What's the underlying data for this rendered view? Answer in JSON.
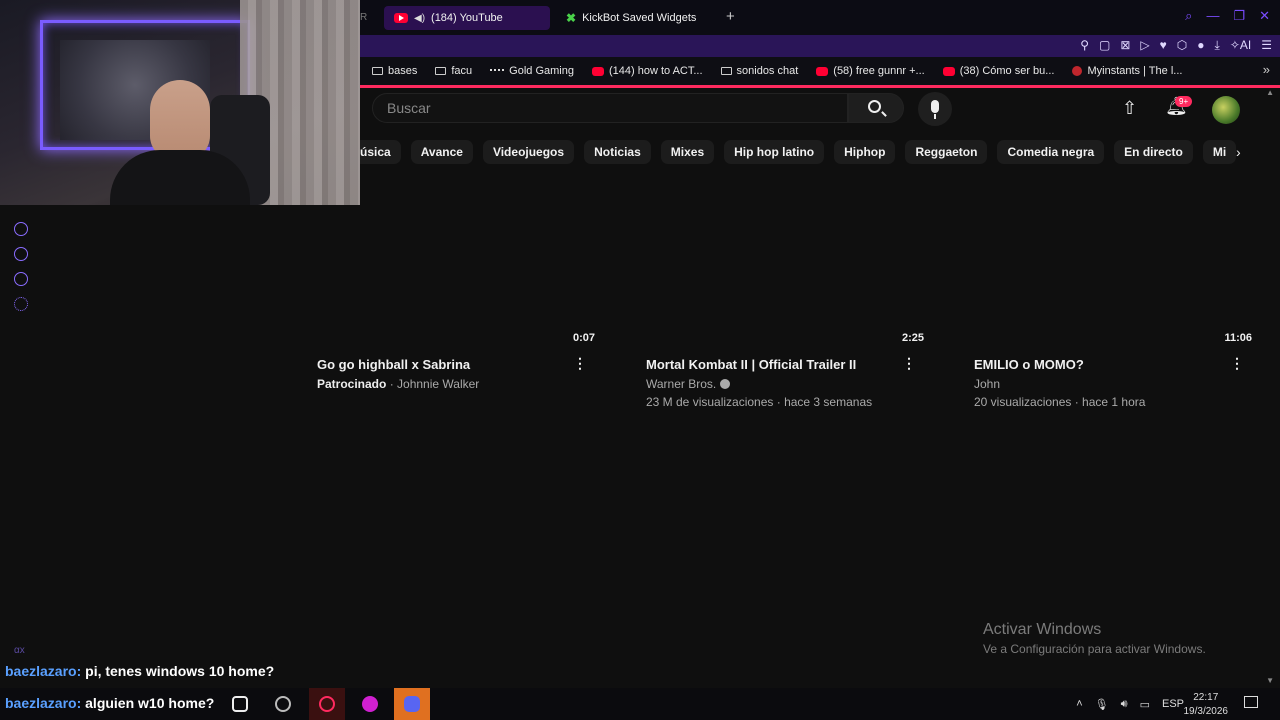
{
  "browser": {
    "tab_fragment": "R",
    "tabs": [
      {
        "label": "(184) YouTube",
        "active": true
      },
      {
        "label": "KickBot Saved Widgets",
        "active": false
      }
    ],
    "new_tab_icon": "plus-icon",
    "toolbar_ai_label": "AI",
    "bookmarks": [
      {
        "label": "bases",
        "icon": "folder-icon"
      },
      {
        "label": "facu",
        "icon": "folder-icon"
      },
      {
        "label": "Gold Gaming",
        "icon": "gold-icon"
      },
      {
        "label": "(144) how to ACT...",
        "icon": "youtube-icon"
      },
      {
        "label": "sonidos chat",
        "icon": "folder-icon"
      },
      {
        "label": "(58) free gunnr +...",
        "icon": "youtube-icon"
      },
      {
        "label": "(38) Cómo ser bu...",
        "icon": "youtube-icon"
      },
      {
        "label": "Myinstants | The l...",
        "icon": "myinstants-icon"
      }
    ]
  },
  "youtube": {
    "search_placeholder": "Buscar",
    "notification_badge": "9+",
    "chips": [
      "úsica",
      "Avance",
      "Videojuegos",
      "Noticias",
      "Mixes",
      "Hip hop latino",
      "Hiphop",
      "Reggaeton",
      "Comedia negra",
      "En directo",
      "Mi"
    ],
    "videos": [
      {
        "duration": "0:07",
        "title": "Go go highball x Sabrina",
        "sponsor": "Patrocinado",
        "channel": "· Johnnie Walker",
        "stats": ""
      },
      {
        "duration": "2:25",
        "title": "Mortal Kombat II | Official Trailer II",
        "channel": "Warner Bros.",
        "verified": true,
        "stats": "23 M de visualizaciones · hace 3 semanas"
      },
      {
        "duration": "11:06",
        "title": "EMILIO o MOMO?",
        "channel": "John",
        "stats": "20 visualizaciones · hace 1 hora"
      }
    ]
  },
  "activate_windows": {
    "title": "Activar Windows",
    "subtitle": "Ve a Configuración para activar Windows."
  },
  "chat": {
    "mini_label": "αx",
    "messages": [
      {
        "user": "baezlazaro:",
        "text": "pi, tenes windows 10 home?"
      },
      {
        "user": "baezlazaro:",
        "text": "alguien w10 home?"
      }
    ]
  },
  "taskbar": {
    "language": "ESP",
    "time": "22:17",
    "date": "19/3/2026"
  },
  "colors": {
    "accent_purple": "#7a4cff",
    "accent_pink": "#ff2a5f",
    "youtube_red": "#ff0033",
    "chat_user": "#5aa0ff"
  }
}
